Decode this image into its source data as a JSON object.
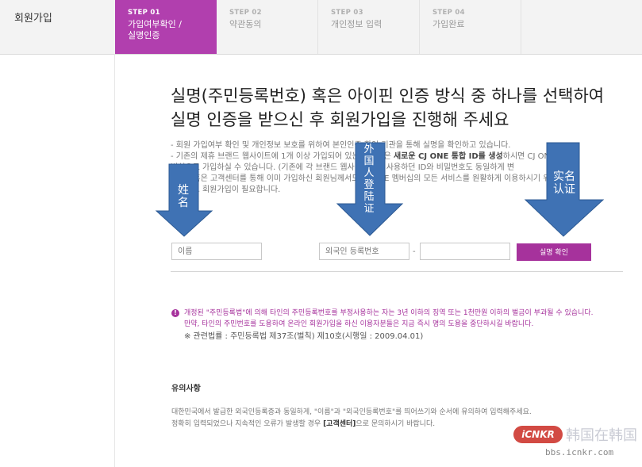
{
  "header": {
    "brand": "회원가입",
    "steps": [
      {
        "num": "STEP 01",
        "line1": "가입여부확인 /",
        "line2": "실명인증",
        "active": true
      },
      {
        "num": "STEP 02",
        "line1": "약관동의",
        "line2": "",
        "active": false
      },
      {
        "num": "STEP 03",
        "line1": "개인정보 입력",
        "line2": "",
        "active": false
      },
      {
        "num": "STEP 04",
        "line1": "가입완료",
        "line2": "",
        "active": false
      }
    ]
  },
  "main": {
    "headline_1": "실명(주민등록번호) 혹은 아이핀 인증 방식 중 하나를 선택하여",
    "headline_2": "실명 인증을 받으신 후 회원가입을 진행해 주세요",
    "notes": [
      "- 회원 가입여부 확인 및 개인정보 보호를 위하여 본인인증 확인 기관을 통해 실명을 확인하고 있습니다.",
      "- 기존의 제휴 브랜드 웹사이트에 1개 이상 가입되어 있는 회원님은",
      "새로운 CJ ONE 통합 ID를 생성",
      "하시면 CJ ONE 멤",
      "버십으로 가입하실 수 있습니다. (기존에 각 브랜드 웹사이트에서 사용하던 ID와 비밀번호도 동일하게 변",
      "- 매장 혹은 고객센터를 통해 이미 가입하신 회원님께서도 CJ ONE 멤버십의 모든 서비스를 원활하게 이용하시기 위해서는",
      "웹사이트 회원가입이 필요합니다."
    ]
  },
  "form": {
    "name_placeholder": "이름",
    "reg_placeholder": "외국인 등록번호",
    "reg2_placeholder": "",
    "dash": "-",
    "verify_label": "실명 확인"
  },
  "warning": {
    "icon": "!",
    "line1": "개정된 \"주민등록법\"에 의해 타인의 주민등록번호를 부정사용하는 자는 3년 이하의 징역 또는 1천만원 이하의 벌금이 부과될 수 있습니다.",
    "line2": "만약, 타인의 주민번호를 도용하여 온라인 회원가입을 하신 이용자분들은 지금 즉시 명의 도용을 중단하시길 바랍니다.",
    "law": "※ 관련법률 : 주민등록법 제37조(벌칙) 제10호(시행일 : 2009.04.01)"
  },
  "caution": {
    "title": "유의사항",
    "line1": "대한민국에서 발급한 외국인등록증과 동일하게, \"이름\"과 \"외국인등록번호\"를 띄어쓰기와 순서에 유의하여 입력해주세요.",
    "line2_pre": "정확히 입력되었으나 지속적인 오류가 발생할 경우",
    "line2_bold": "[고객센터]",
    "line2_post": "으로 문의하시기 바랍니다."
  },
  "annotations": {
    "arrow_name": "姓名",
    "arrow_reg": "外国人登陆证",
    "arrow_verify_1": "实名",
    "arrow_verify_2": "认证",
    "arrow_color": "#3f72b4"
  },
  "watermark": {
    "logo": "iCNKR",
    "site_cn": "韩国在韩国",
    "url": "bbs.icnkr.com"
  },
  "colors": {
    "accent": "#b13fae",
    "button": "#a6329c",
    "header_bg": "#f3f3f3"
  }
}
